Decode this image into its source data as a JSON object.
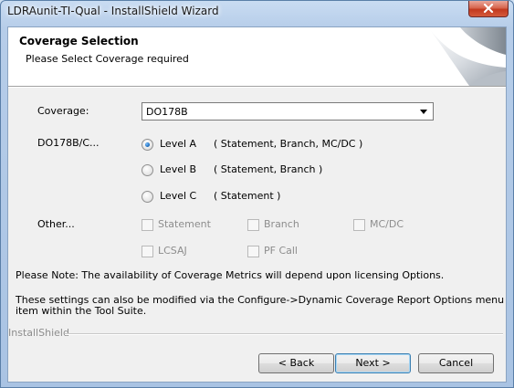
{
  "window": {
    "title": "LDRAunit-TI-Qual - InstallShield Wizard"
  },
  "header": {
    "title": "Coverage Selection",
    "subtitle": "Please Select Coverage required"
  },
  "coverage": {
    "label": "Coverage:",
    "selected": "DO178B"
  },
  "level": {
    "label": "DO178B/C...",
    "options": [
      {
        "label": "Level A",
        "desc": "( Statement, Branch, MC/DC )",
        "checked": true
      },
      {
        "label": "Level B",
        "desc": "( Statement, Branch )",
        "checked": false
      },
      {
        "label": "Level C",
        "desc": "( Statement )",
        "checked": false
      }
    ]
  },
  "other": {
    "label": "Other...",
    "checkboxes": [
      "Statement",
      "Branch",
      "MC/DC",
      "LCSAJ",
      "PF Call"
    ]
  },
  "notes": {
    "line1": "Please Note: The availability of Coverage Metrics will depend upon licensing Options.",
    "line2a": "These settings can also be modified via the Configure->Dynamic Coverage Report Options menu",
    "line2b": "item within the Tool Suite."
  },
  "footer": {
    "brand": "InstallShield"
  },
  "buttons": {
    "back": "< Back",
    "next": "Next >",
    "cancel": "Cancel"
  }
}
